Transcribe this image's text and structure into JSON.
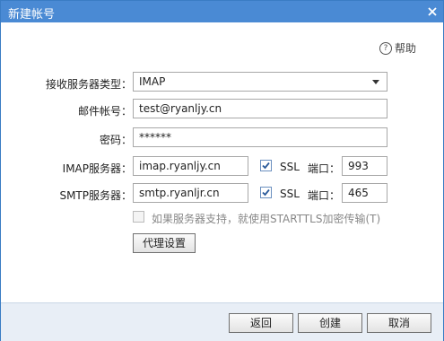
{
  "window": {
    "title": "新建帐号",
    "close_icon": "close-icon"
  },
  "help": {
    "label": "帮助",
    "icon": "help-circle-icon"
  },
  "form": {
    "server_type_label": "接收服务器类型：",
    "server_type_value": "IMAP",
    "account_label": "邮件帐号：",
    "account_value": "test@ryanljy.cn",
    "password_label": "密码：",
    "password_value": "******",
    "imap_label": "IMAP服务器：",
    "imap_server": "imap.ryanljy.cn",
    "imap_ssl_label": "SSL",
    "imap_ssl_checked": true,
    "imap_port_label": "端口：",
    "imap_port": "993",
    "smtp_label": "SMTP服务器：",
    "smtp_server": "smtp.ryanljr.cn",
    "smtp_ssl_label": "SSL",
    "smtp_ssl_checked": true,
    "smtp_port_label": "端口：",
    "smtp_port": "465",
    "starttls_label": "如果服务器支持，就使用STARTTLS加密传输(T)",
    "starttls_checked": false,
    "proxy_button": "代理设置"
  },
  "footer": {
    "back_button": "返回",
    "create_button": "创建",
    "cancel_button": "取消"
  },
  "colors": {
    "titlebar": "#4a8ad4",
    "footer": "#e8eef6",
    "checkmark": "#2a5a9a"
  }
}
